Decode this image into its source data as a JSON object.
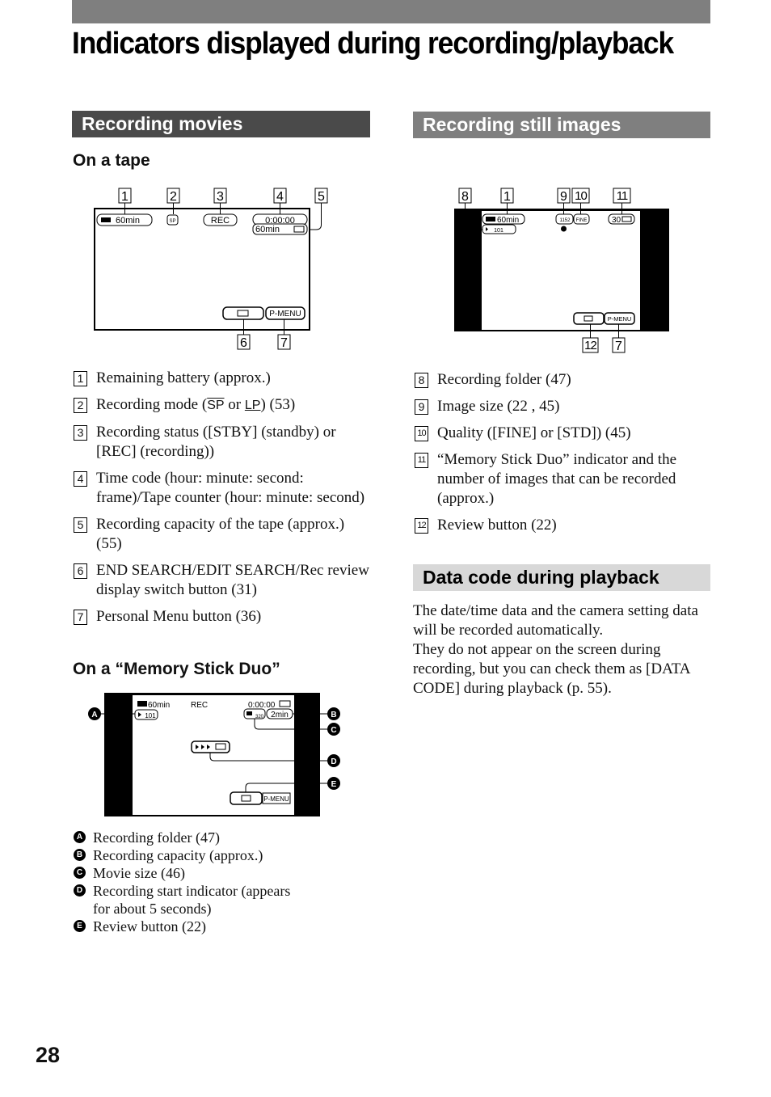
{
  "page": {
    "title": "Indicators displayed during recording/playback",
    "page_number": "28"
  },
  "recording_movies": {
    "heading": "Recording movies",
    "tape": {
      "subheading": "On a tape",
      "callouts": [
        "1",
        "2",
        "3",
        "4",
        "5",
        "6",
        "7"
      ],
      "screen": {
        "battery": "60min",
        "mode": "SP",
        "status": "REC",
        "timecode": "0:00:00",
        "tape_remaining": "60min",
        "pmenu": "P-MENU"
      },
      "items": [
        {
          "num": "1",
          "text": "Remaining battery (approx.)"
        },
        {
          "num": "2",
          "text_pre": "Recording mode  (",
          "sp": "SP",
          "mid": " or ",
          "lp": "LP",
          "text_post": ") (53)"
        },
        {
          "num": "3",
          "text": "Recording status ([STBY] (standby) or [REC] (recording))"
        },
        {
          "num": "4",
          "text": "Time code (hour: minute: second: frame)/Tape counter (hour: minute: second)"
        },
        {
          "num": "5",
          "text": "Recording capacity of the tape (approx.) (55)"
        },
        {
          "num": "6",
          "text": "END SEARCH/EDIT SEARCH/Rec review display switch button (31)"
        },
        {
          "num": "7",
          "text": "Personal Menu button (36)"
        }
      ]
    },
    "memory_stick": {
      "subheading": "On a “Memory Stick Duo”",
      "callouts": [
        "A",
        "B",
        "C",
        "D",
        "E"
      ],
      "screen": {
        "battery": "60min",
        "status": "REC",
        "timecode": "0:00:00",
        "folder": "101",
        "movie_size": "320",
        "capacity": "2min",
        "pmenu": "P-MENU"
      },
      "items": [
        {
          "letter": "A",
          "text": "Recording folder (47)"
        },
        {
          "letter": "B",
          "text": "Recording capacity (approx.)"
        },
        {
          "letter": "C",
          "text": "Movie size (46)"
        },
        {
          "letter": "D",
          "text": "Recording start indicator (appears for about 5 seconds)"
        },
        {
          "letter": "E",
          "text": "Review button (22)"
        }
      ]
    }
  },
  "recording_still": {
    "heading": "Recording still images",
    "callouts": [
      "8",
      "1",
      "9",
      "10",
      "11",
      "12",
      "7"
    ],
    "screen": {
      "battery": "60min",
      "folder": "101",
      "image_size": "1152",
      "quality": "FINE",
      "count": "30",
      "pmenu": "P-MENU"
    },
    "items": [
      {
        "num": "8",
        "text": "Recording folder (47)"
      },
      {
        "num": "9",
        "text": "Image size (22 , 45)"
      },
      {
        "num": "10",
        "text": "Quality ([FINE] or [STD]) (45)"
      },
      {
        "num": "11",
        "text": "“Memory Stick Duo” indicator and the number of images that can be recorded (approx.)"
      },
      {
        "num": "12",
        "text": "Review button (22)"
      }
    ]
  },
  "data_code": {
    "heading": "Data code during playback",
    "paragraph_1": "The date/time data and the camera setting data will be recorded automatically.",
    "paragraph_2": "They do not appear on the screen during recording, but you can check them as [DATA CODE] during playback (p. 55)."
  }
}
